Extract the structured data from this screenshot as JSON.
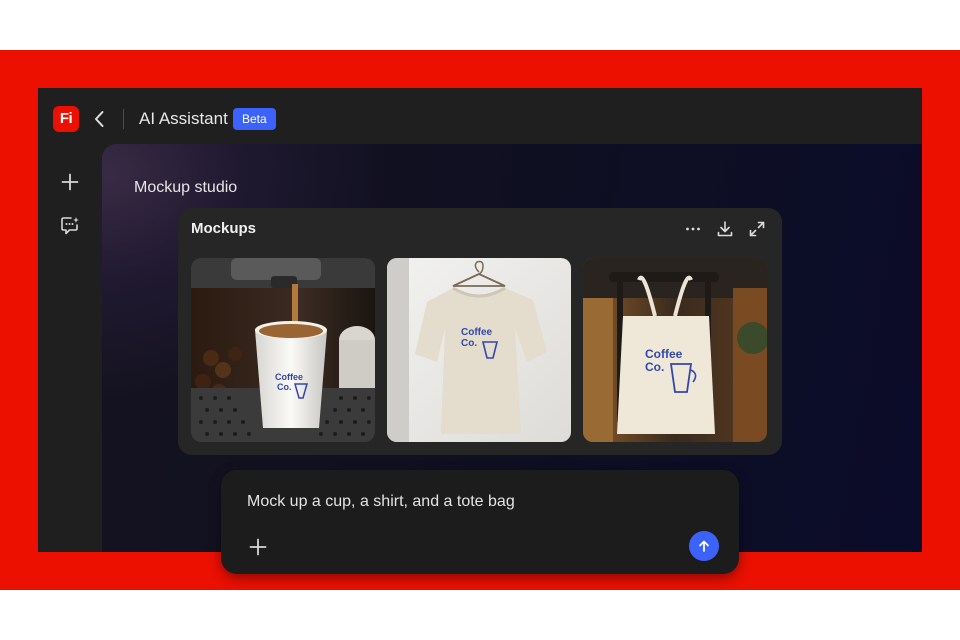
{
  "colors": {
    "brand_red": "#eb1000",
    "accent_blue": "#3b63fb",
    "app_bg": "#1f1f1f",
    "card_bg": "#262626"
  },
  "header": {
    "logo_text": "Fi",
    "title": "AI Assistant",
    "badge": "Beta"
  },
  "rail": {
    "icons": [
      "plus-icon",
      "chat-sparkle-icon"
    ]
  },
  "main": {
    "section_title": "Mockup studio",
    "card": {
      "title": "Mockups",
      "actions": [
        "more-icon",
        "download-icon",
        "expand-icon"
      ],
      "thumbnails": [
        {
          "subject": "paper cup",
          "brand_line1": "Coffee",
          "brand_line2": "Co."
        },
        {
          "subject": "t-shirt",
          "brand_line1": "Coffee",
          "brand_line2": "Co."
        },
        {
          "subject": "tote bag",
          "brand_line1": "Coffee",
          "brand_line2": "Co."
        }
      ]
    }
  },
  "prompt": {
    "text": "Mock up a cup, a shirt, and a tote bag",
    "add_icon": "plus-icon",
    "send_icon": "arrow-up-icon"
  }
}
